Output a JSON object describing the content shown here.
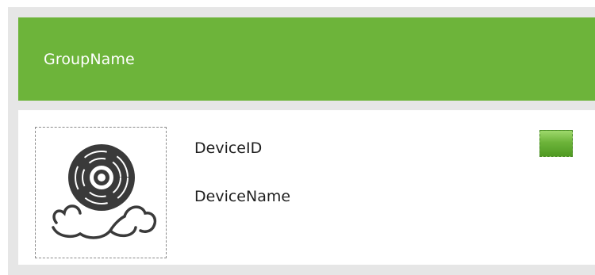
{
  "group": {
    "name": "GroupName"
  },
  "device": {
    "id_label": "DeviceID",
    "name_label": "DeviceName",
    "image_icon": "disc-cloud-icon",
    "status_icon": "status-indicator-icon",
    "status_color": "#6db43a"
  },
  "colors": {
    "header_background": "#6db43a",
    "header_text": "#ffffff",
    "frame_background": "#e6e6e6",
    "card_background": "#ffffff"
  }
}
